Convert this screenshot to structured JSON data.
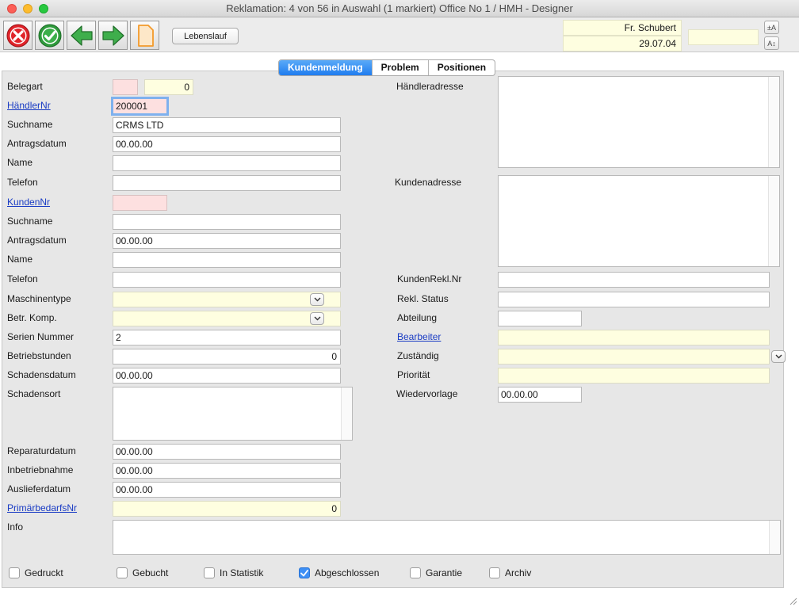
{
  "window": {
    "title": "Reklamation: 4 von 56 in Auswahl  (1 markiert) Office No 1 /  HMH - Designer"
  },
  "toolbar": {
    "buttons": [
      {
        "name": "cancel",
        "icon": "x-circle-icon",
        "color": "#e0242a"
      },
      {
        "name": "ok",
        "icon": "check-circle-icon",
        "color": "#2f9a3c"
      },
      {
        "name": "previous",
        "icon": "arrow-left-icon",
        "color": "#38a048"
      },
      {
        "name": "next",
        "icon": "arrow-right-icon",
        "color": "#38a048"
      },
      {
        "name": "new",
        "icon": "document-icon",
        "color": "#f39a2b"
      }
    ],
    "lebenslauf_label": "Lebenslauf",
    "user": "Fr. Schubert",
    "date": "29.07.04",
    "extra": "",
    "font_larger": "±A",
    "font_smaller": "A↕"
  },
  "tabs": [
    {
      "label": "Kundenmeldung",
      "active": true
    },
    {
      "label": "Problem",
      "active": false
    },
    {
      "label": "Positionen",
      "active": false
    }
  ],
  "left": {
    "belegart": {
      "label": "Belegart",
      "code": "",
      "value": "0"
    },
    "haendler_nr": {
      "label": "HändlerNr",
      "value": "200001"
    },
    "suchname1": {
      "label": "Suchname",
      "value": "CRMS LTD"
    },
    "antragsdatum1": {
      "label": "Antragsdatum",
      "value": "00.00.00"
    },
    "name1": {
      "label": "Name",
      "value": ""
    },
    "telefon1": {
      "label": "Telefon",
      "value": ""
    },
    "kunden_nr": {
      "label": "KundenNr",
      "value": ""
    },
    "suchname2": {
      "label": "Suchname",
      "value": ""
    },
    "antragsdatum2": {
      "label": "Antragsdatum",
      "value": "00.00.00"
    },
    "name2": {
      "label": "Name",
      "value": ""
    },
    "telefon2": {
      "label": "Telefon",
      "value": ""
    },
    "maschinentype": {
      "label": "Maschinentype",
      "value": ""
    },
    "betr_komp": {
      "label": "Betr. Komp.",
      "value": ""
    },
    "serien_nummer": {
      "label": "Serien Nummer",
      "value": "2"
    },
    "betriebsstunden": {
      "label": "Betriebstunden",
      "value": "0"
    },
    "schadensdatum": {
      "label": "Schadensdatum",
      "value": "00.00.00"
    },
    "schadensort": {
      "label": "Schadensort",
      "value": ""
    },
    "reparaturdatum": {
      "label": "Reparaturdatum",
      "value": "00.00.00"
    },
    "inbetriebnahme": {
      "label": "Inbetriebnahme",
      "value": "00.00.00"
    },
    "auslieferdatum": {
      "label": "Auslieferdatum",
      "value": "00.00.00"
    },
    "primaerbedarfs_nr": {
      "label": "PrimärbedarfsNr",
      "value": "0"
    },
    "info": {
      "label": "Info",
      "value": ""
    }
  },
  "right": {
    "haendleradresse": {
      "label": "Händleradresse",
      "value": ""
    },
    "kundenadresse": {
      "label": "Kundenadresse",
      "value": ""
    },
    "kunden_rekl_nr": {
      "label": "KundenRekl.Nr",
      "value": ""
    },
    "rekl_status": {
      "label": "Rekl. Status",
      "value": ""
    },
    "abteilung": {
      "label": "Abteilung",
      "value": ""
    },
    "bearbeiter": {
      "label": "Bearbeiter",
      "value": ""
    },
    "zustaendig": {
      "label": "Zuständig",
      "value": ""
    },
    "prioritaet": {
      "label": "Priorität",
      "value": ""
    },
    "wiedervorlage": {
      "label": "Wiedervorlage",
      "value": "00.00.00"
    }
  },
  "checkboxes": [
    {
      "label": "Gedruckt",
      "checked": false
    },
    {
      "label": "Gebucht",
      "checked": false
    },
    {
      "label": "In Statistik",
      "checked": false
    },
    {
      "label": "Abgeschlossen",
      "checked": true
    },
    {
      "label": "Garantie",
      "checked": false
    },
    {
      "label": "Archiv",
      "checked": false
    }
  ]
}
